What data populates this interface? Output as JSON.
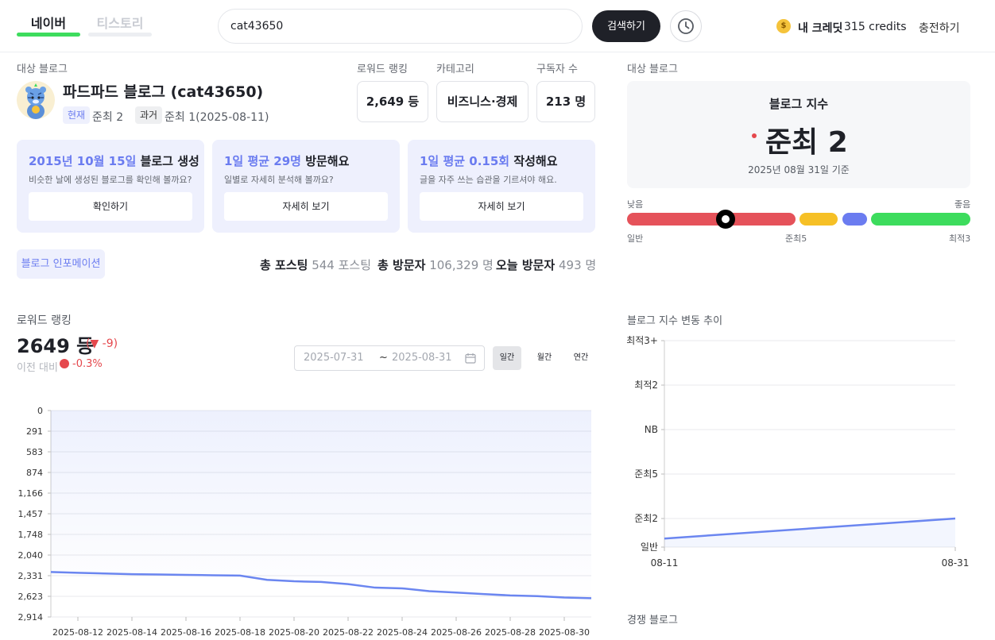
{
  "header": {
    "tabs": [
      {
        "label": "네이버",
        "active": true
      },
      {
        "label": "티스토리",
        "active": false
      }
    ],
    "search_value": "cat43650",
    "search_button": "검색하기",
    "history_icon": "clock-icon",
    "credits_label": "내 크레딧",
    "credits_value": "315 credits",
    "charge_label": "충전하기",
    "coin_icon": "coin-icon",
    "coin_symbol": "$"
  },
  "blog": {
    "section_label": "대상 블로그",
    "name": "파드파드 블로그 (cat43650)",
    "current_chip": "현재",
    "current_grade": "준최 2",
    "past_chip": "과거",
    "past_grade": "준최 1(2025-08-11)"
  },
  "stats": [
    {
      "label": "로워드 랭킹",
      "value": "2,649 등"
    },
    {
      "label": "카테고리",
      "value": "비즈니스·경제"
    },
    {
      "label": "구독자 수",
      "value": "213 명"
    }
  ],
  "cards": [
    {
      "highlight": "2015년 10월 15일",
      "title": "블로그 생성",
      "subtitle": "비슷한 날에 생성된 블로그를 확인해 볼까요?",
      "button": "확인하기"
    },
    {
      "highlight": "1일 평균 29명",
      "title": "방문해요",
      "subtitle": "일별로 자세히 분석해 볼까요?",
      "button": "자세히 보기"
    },
    {
      "highlight": "1일 평균 0.15회",
      "title": "작성해요",
      "subtitle": "글을 자주 쓰는 습관을 기르셔야 해요.",
      "button": "자세히 보기"
    }
  ],
  "info_chip": "블로그 인포메이션",
  "totals": [
    {
      "label": "총 포스팅",
      "value": "544 포스팅"
    },
    {
      "label": "총 방문자",
      "value": "106,329 명"
    },
    {
      "label": "오늘 방문자",
      "value": "493 명"
    }
  ],
  "index_panel": {
    "section_label": "대상 블로그",
    "title": "블로그 지수",
    "grade": "준최 2",
    "date": "2025년 08월 31일 기준",
    "low_label": "낮음",
    "high_label": "좋음",
    "tick_left": "일반",
    "tick_mid": "준최5",
    "tick_right": "최적3",
    "colors": {
      "red": "#e5525a",
      "yellow": "#f6c026",
      "blue": "#6b7cf0",
      "green": "#3ddc5d"
    }
  },
  "ranking": {
    "section_label": "로워드 랭킹",
    "value": "2649 등",
    "change": "(▼ -9)",
    "prev_label": "이전 대비",
    "prev_value": "-0.3%",
    "date_from": "2025-07-31",
    "date_to": "2025-08-31",
    "tilde": "~",
    "calendar_icon": "calendar-icon",
    "periods": [
      "일간",
      "월간",
      "연간"
    ],
    "active_period": "일간"
  },
  "index_trend": {
    "section_label": "블로그 지수 변동 추이"
  },
  "competitor_label": "경쟁 블로그",
  "chart_data": [
    {
      "type": "area",
      "title": "",
      "xlabel": "",
      "ylabel": "",
      "y_inverted": true,
      "ylim": [
        0,
        2914
      ],
      "yticks": [
        "0",
        "291",
        "583",
        "874",
        "1,166",
        "1,457",
        "1,748",
        "2,040",
        "2,331",
        "2,623",
        "2,914"
      ],
      "xticks": [
        "2025-08-12",
        "2025-08-14",
        "2025-08-16",
        "2025-08-18",
        "2025-08-20",
        "2025-08-22",
        "2025-08-24",
        "2025-08-26",
        "2025-08-28",
        "2025-08-30"
      ],
      "x": [
        "2025-08-11",
        "2025-08-12",
        "2025-08-13",
        "2025-08-14",
        "2025-08-15",
        "2025-08-16",
        "2025-08-17",
        "2025-08-18",
        "2025-08-19",
        "2025-08-20",
        "2025-08-21",
        "2025-08-22",
        "2025-08-23",
        "2025-08-24",
        "2025-08-25",
        "2025-08-26",
        "2025-08-27",
        "2025-08-28",
        "2025-08-29",
        "2025-08-30",
        "2025-08-31"
      ],
      "series": [
        {
          "values": [
            2280,
            2290,
            2300,
            2310,
            2315,
            2320,
            2325,
            2330,
            2390,
            2410,
            2420,
            2450,
            2500,
            2510,
            2550,
            2570,
            2590,
            2610,
            2620,
            2640,
            2649
          ],
          "color": "#6b86f0"
        }
      ]
    },
    {
      "type": "line",
      "title": "",
      "xlabel": "",
      "ylabel": "",
      "yticks": [
        "최적3+",
        "최적2",
        "NB",
        "준최5",
        "준최2",
        "일반"
      ],
      "xticks": [
        "08-11",
        "08-31"
      ],
      "series": [
        {
          "values": [
            0.3,
            1.0
          ],
          "color": "#6b86f0"
        }
      ]
    }
  ]
}
